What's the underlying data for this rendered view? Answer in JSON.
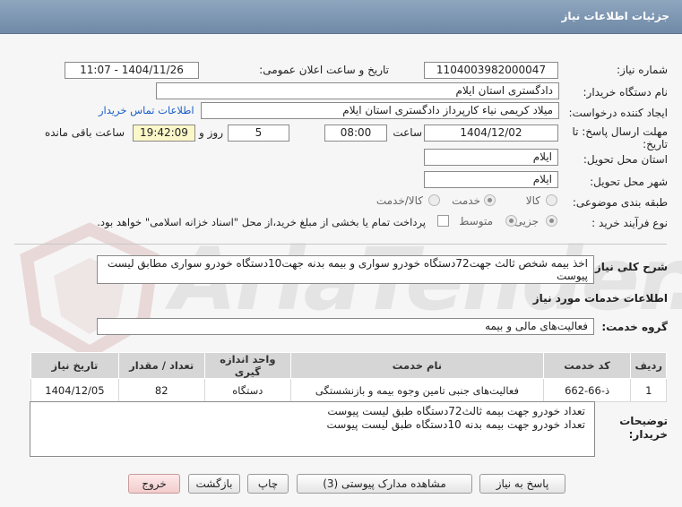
{
  "header": {
    "title": "جزئیات اطلاعات نیاز"
  },
  "fields": {
    "need_number_label": "شماره نیاز:",
    "need_number": "1104003982000047",
    "announce_label": "تاریخ و ساعت اعلان عمومی:",
    "announce_value": "1404/11/26 - 11:07",
    "buyer_org_label": "نام دستگاه خریدار:",
    "buyer_org": "دادگستری استان ایلام",
    "creator_label": "ایجاد کننده درخواست:",
    "creator": "میلاد کریمی نیاء کارپرداز دادگستری استان ایلام",
    "contact_link": "اطلاعات تماس خریدار",
    "deadline_label_1": "مهلت ارسال پاسخ: تا",
    "deadline_label_2": "تاریخ:",
    "deadline_date": "1404/12/02",
    "time_label": "ساعت",
    "deadline_time": "08:00",
    "days_value": "5",
    "days_label": "روز و",
    "remaining_time": "19:42:09",
    "remaining_label": "ساعت باقی مانده",
    "province_label": "استان محل تحویل:",
    "province": "ایلام",
    "city_label": "شهر محل تحویل:",
    "city": "ایلام",
    "category_label": "طبقه بندی موضوعی:",
    "category_options": [
      "کالا",
      "خدمت",
      "کالا/خدمت"
    ],
    "category_selected": "خدمت",
    "process_label": "نوع فرآیند خرید :",
    "process_options": [
      "جزیی",
      "متوسط"
    ],
    "process_selected": "جزیی",
    "payment_note": "پرداخت تمام یا بخشی از مبلغ خرید،از محل \"اسناد خزانه اسلامی\" خواهد بود."
  },
  "summary": {
    "label": "شرح کلی نیاز:",
    "text": "اخذ بیمه شخص ثالث جهت72دستگاه خودرو سواری و  بیمه بدنه جهت10دستگاه خودرو  سواری مطابق لیست پیوست"
  },
  "services": {
    "section_title": "اطلاعات خدمات مورد نیاز",
    "group_label": "گروه خدمت:",
    "group_value": "فعالیت‌های مالی و بیمه",
    "columns": [
      "ردیف",
      "کد خدمت",
      "نام خدمت",
      "واحد اندازه گیری",
      "تعداد / مقدار",
      "تاریخ نیاز"
    ],
    "rows": [
      {
        "index": "1",
        "code": "ذ-66-662",
        "name": "فعالیت‌های جنبی تامین وجوه بیمه و بازنشستگی",
        "unit": "دستگاه",
        "qty": "82",
        "date": "1404/12/05"
      }
    ]
  },
  "buyer_notes": {
    "label_1": "توضیحات",
    "label_2": "خریدار:",
    "lines": [
      "تعداد خودرو جهت بیمه ثالث72دستگاه طبق لیست پیوست",
      "تعداد خودرو جهت بیمه بدنه 10دستگاه طبق لیست پیوست"
    ]
  },
  "buttons": {
    "reply": "پاسخ به نیاز",
    "attachments": "مشاهده مدارک پیوستی (3)",
    "print": "چاپ",
    "back": "بازگشت",
    "exit": "خروج"
  },
  "colors": {
    "header": "#7790ab",
    "link": "#1a5fc8",
    "highlight_box": "#fbf7c9",
    "exit_button": "#f3cccc"
  }
}
